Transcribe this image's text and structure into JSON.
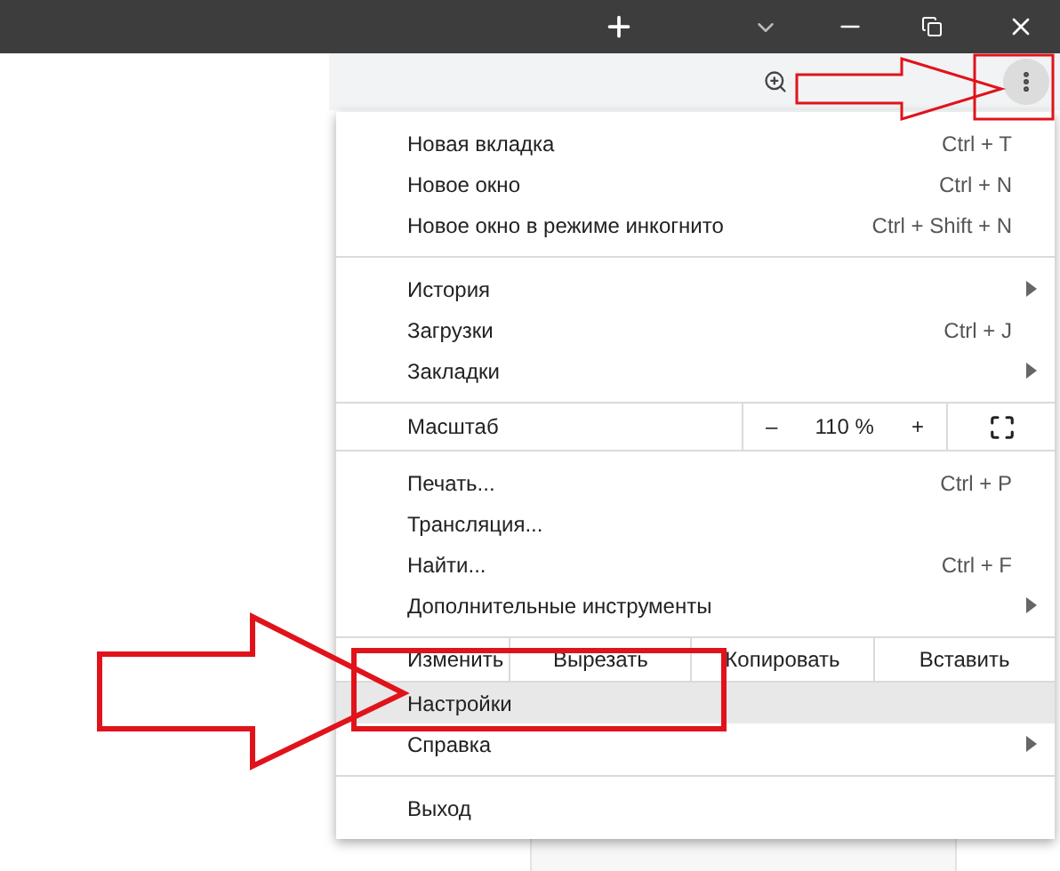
{
  "menu": {
    "sections": [
      {
        "items": [
          {
            "kind": "item",
            "label": "Новая вкладка",
            "shortcut": "Ctrl + T",
            "submenu": false,
            "selected": false
          },
          {
            "kind": "item",
            "label": "Новое окно",
            "shortcut": "Ctrl + N",
            "submenu": false,
            "selected": false
          },
          {
            "kind": "item",
            "label": "Новое окно в режиме инкогнито",
            "shortcut": "Ctrl + Shift + N",
            "submenu": false,
            "selected": false
          }
        ]
      },
      {
        "items": [
          {
            "kind": "item",
            "label": "История",
            "submenu": true,
            "selected": false
          },
          {
            "kind": "item",
            "label": "Загрузки",
            "shortcut": "Ctrl + J",
            "submenu": false,
            "selected": false
          },
          {
            "kind": "item",
            "label": "Закладки",
            "submenu": true,
            "selected": false
          }
        ]
      },
      {
        "items": [
          {
            "kind": "zoom",
            "label": "Масштаб",
            "minus": "–",
            "value": "110 %",
            "plus": "+"
          }
        ]
      },
      {
        "items": [
          {
            "kind": "item",
            "label": "Печать...",
            "shortcut": "Ctrl + P",
            "submenu": false,
            "selected": false
          },
          {
            "kind": "item",
            "label": "Трансляция...",
            "submenu": false,
            "selected": false
          },
          {
            "kind": "item",
            "label": "Найти...",
            "shortcut": "Ctrl + F",
            "submenu": false,
            "selected": false
          },
          {
            "kind": "item",
            "label": "Дополнительные инструменты",
            "submenu": true,
            "selected": false
          }
        ]
      },
      {
        "items": [
          {
            "kind": "edit",
            "label": "Изменить",
            "actions": [
              "Вырезать",
              "Копировать",
              "Вставить"
            ]
          },
          {
            "kind": "item",
            "label": "Настройки",
            "submenu": false,
            "selected": true
          },
          {
            "kind": "item",
            "label": "Справка",
            "submenu": true,
            "selected": false
          }
        ]
      },
      {
        "items": [
          {
            "kind": "item",
            "label": "Выход",
            "submenu": false,
            "selected": false
          }
        ]
      }
    ]
  }
}
